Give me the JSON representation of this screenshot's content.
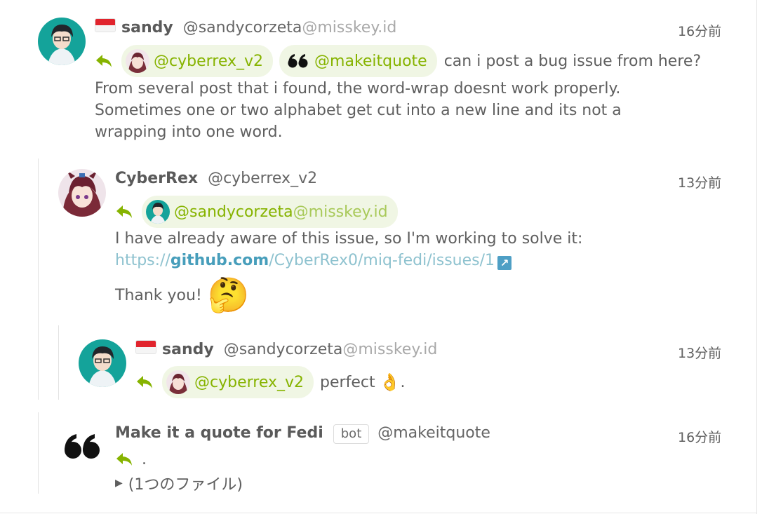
{
  "note1": {
    "name": "sandy",
    "username": "@sandycorzeta",
    "host": "@misskey.id",
    "time": "16分前",
    "mention1": "@cyberrex_v2",
    "mention2": "@makeitquote",
    "text_inline": "can i post a bug issue from here?",
    "text_lines": [
      "From several post that i found, the word-wrap doesnt work properly.",
      "Sometimes one or two alphabet get cut into a new line and its not a",
      "wrapping into one word."
    ]
  },
  "note2": {
    "name": "CyberRex",
    "username": "@cyberrex_v2",
    "time": "13分前",
    "mention_user": "@sandycorzeta",
    "mention_host": "@misskey.id",
    "text_line1": "I have already aware of this issue, so I'm working to solve it:",
    "link_scheme": "https://",
    "link_host": "github.com",
    "link_path": "/CyberRex0/miq-fedi/issues/1",
    "thanks": "Thank you!",
    "emoji": "🤔"
  },
  "note3": {
    "name": "sandy",
    "username": "@sandycorzeta",
    "host": "@misskey.id",
    "time": "13分前",
    "mention": "@cyberrex_v2",
    "text": "perfect",
    "emoji": "👌",
    "text_after": "."
  },
  "note4": {
    "name": "Make it a quote for Fedi",
    "badge": "bot",
    "username": "@makeitquote",
    "time": "16分前",
    "text": ".",
    "files_toggle": "(1つのファイル)"
  },
  "icons": {
    "reply": "reply-arrow-icon",
    "external": "external-link-icon",
    "disclosure": "triangle-right-icon"
  },
  "colors": {
    "accent": "#86b300",
    "mention_bg": "#f0f6e4",
    "link": "#479ebb"
  }
}
